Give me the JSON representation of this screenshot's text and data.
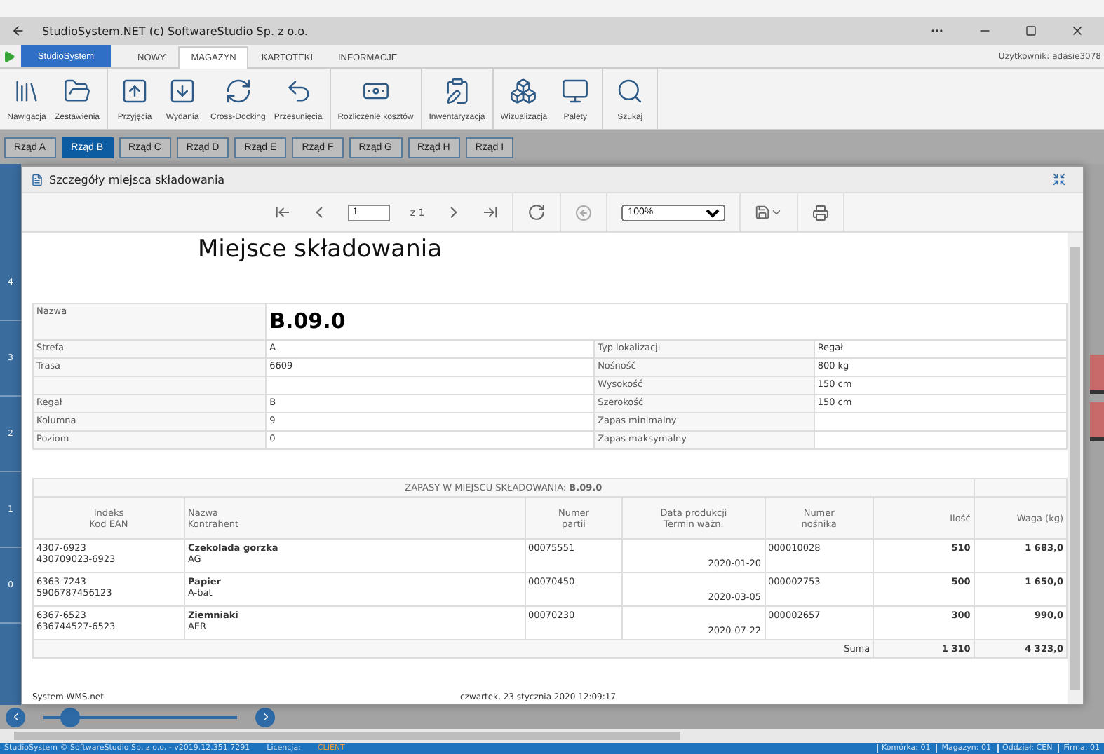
{
  "window": {
    "title": "StudioSystem.NET (c) SoftwareStudio Sp. z o.o."
  },
  "menu_tabs": [
    {
      "label": "StudioSystem",
      "kind": "app",
      "selected": false
    },
    {
      "label": "NOWY",
      "kind": "tab",
      "selected": false
    },
    {
      "label": "MAGAZYN",
      "kind": "tab",
      "selected": true
    },
    {
      "label": "KARTOTEKI",
      "kind": "tab",
      "selected": false
    },
    {
      "label": "INFORMACJE",
      "kind": "tab",
      "selected": false
    }
  ],
  "user": "Użytkownik: adasie3078",
  "ribbon": {
    "groups": [
      {
        "items": [
          "Nawigacja",
          "Zestawienia"
        ]
      },
      {
        "items": [
          "Przyjęcia",
          "Wydania",
          "Cross-Docking",
          "Przesunięcia"
        ]
      },
      {
        "items": [
          "Rozliczenie kosztów"
        ]
      },
      {
        "items": [
          "Inwentaryzacja"
        ]
      },
      {
        "items": [
          "Wizualizacja",
          "Palety"
        ]
      },
      {
        "items": [
          "Szukaj"
        ]
      }
    ]
  },
  "rows_tabs": [
    {
      "label": "Rząd A",
      "selected": false
    },
    {
      "label": "Rząd B",
      "selected": true
    },
    {
      "label": "Rząd C",
      "selected": false
    },
    {
      "label": "Rząd D",
      "selected": false
    },
    {
      "label": "Rząd E",
      "selected": false
    },
    {
      "label": "Rząd F",
      "selected": false
    },
    {
      "label": "Rząd G",
      "selected": false
    },
    {
      "label": "Rząd H",
      "selected": false
    },
    {
      "label": "Rząd I",
      "selected": false
    }
  ],
  "grid_levels": [
    "4",
    "3",
    "2",
    "1",
    "0"
  ],
  "dialog": {
    "title": "Szczegóły miejsca składowania",
    "toolbar": {
      "page": "1",
      "page_count": "z 1",
      "zoom": "100%"
    },
    "report": {
      "title": "Miejsce składowania",
      "name_label": "Nazwa",
      "name_value": "B.09.0",
      "details": [
        {
          "label": "Strefa",
          "value": "A",
          "label2": "Typ lokalizacji",
          "value2": "Regał"
        },
        {
          "label": "Trasa",
          "value": "6609",
          "label2": "Nośność",
          "value2": "800 kg"
        },
        {
          "label2": "Wysokość",
          "value2": "150 cm"
        },
        {
          "label": "Regał",
          "value": "B",
          "label2": "Szerokość",
          "value2": "150 cm"
        },
        {
          "label": "Kolumna",
          "value": "9",
          "label2": "Zapas minimalny"
        },
        {
          "label": "Poziom",
          "value": "0",
          "label2": "Zapas maksymalny"
        }
      ],
      "stock": {
        "title": "ZAPASY W MIEJSCU SKŁADOWANIA: **B.09.0**",
        "columns": [
          "Indeks\nKod EAN",
          "Nazwa\nKontrahent",
          "Numer\npartii",
          "Data produkcji\nTermin ważn.",
          "Numer\nnośnika",
          "Ilość",
          "Waga (kg)"
        ],
        "rows": [
          {
            "index": "4307-6923",
            "ean": "430709023-6923",
            "name": "Czekolada gorzka",
            "contractor": "AG",
            "batch": "00075551",
            "date": "2020-01-20",
            "carrier": "000010028",
            "qty": "510",
            "weight": "1 683,0"
          },
          {
            "index": "6363-7243",
            "ean": "5906787456123",
            "name": "Papier",
            "contractor": "A-bat",
            "batch": "00070450",
            "date": "2020-03-05",
            "carrier": "000002753",
            "qty": "500",
            "weight": "1 650,0"
          },
          {
            "index": "6367-6523",
            "ean": "636744527-6523",
            "name": "Ziemniaki",
            "contractor": "AER",
            "batch": "00070230",
            "date": "2020-07-22",
            "carrier": "000002657",
            "qty": "300",
            "weight": "990,0"
          }
        ],
        "sum_label": "Suma",
        "sum_qty": "1 310",
        "sum_weight": "4 323,0"
      },
      "footer_left": "System WMS.net",
      "footer_right": "czwartek, 23 stycznia 2020 12:09:17"
    }
  },
  "slider": {
    "level": 0.14
  },
  "status_bar": {
    "copyright": "StudioSystem © SoftwareStudio Sp. z o.o. - v2019.12.351.7291",
    "license_label": "Licencja:",
    "license": "CLIENT",
    "fields": [
      "Komórka: 01",
      "Magazyn: 01",
      "Oddział: CEN",
      "Firma: 01"
    ]
  }
}
